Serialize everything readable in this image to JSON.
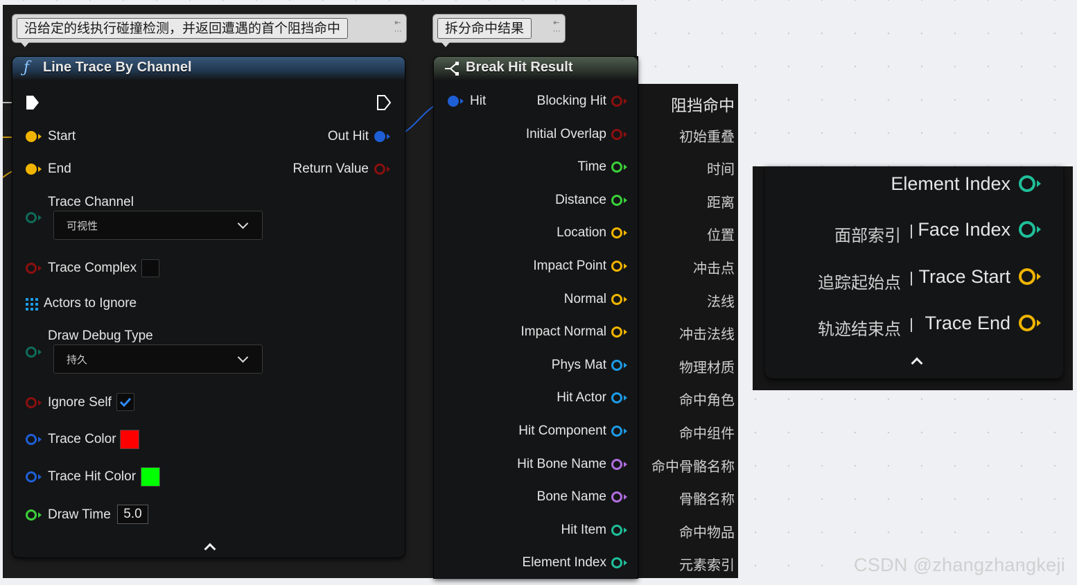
{
  "comments": {
    "trace_comment": "沿给定的线执行碰撞检测，并返回遭遇的首个阻挡命中",
    "break_comment": "拆分命中结果"
  },
  "line_trace": {
    "title": "Line Trace By Channel",
    "inputs": {
      "start": "Start",
      "end": "End",
      "trace_channel": "Trace Channel",
      "trace_channel_value": "可视性",
      "trace_complex": "Trace Complex",
      "actors_to_ignore": "Actors to Ignore",
      "draw_debug_type": "Draw Debug Type",
      "draw_debug_type_value": "持久",
      "ignore_self": "Ignore Self",
      "trace_color": "Trace Color",
      "trace_hit_color": "Trace Hit Color",
      "draw_time": "Draw Time",
      "draw_time_value": "5.0"
    },
    "outputs": {
      "out_hit": "Out Hit",
      "return_value": "Return Value"
    },
    "trace_complex_checked": false,
    "ignore_self_checked": true,
    "trace_color_hex": "#ff0000",
    "trace_hit_color_hex": "#00ff00"
  },
  "break_hit": {
    "title": "Break Hit Result",
    "input": "Hit",
    "outputs": [
      {
        "label": "Blocking Hit",
        "zh": "阻挡命中",
        "color": "#8b0f0f"
      },
      {
        "label": "Initial Overlap",
        "zh": "初始重叠",
        "color": "#8b0f0f"
      },
      {
        "label": "Time",
        "zh": "时间",
        "color": "#3bd13b"
      },
      {
        "label": "Distance",
        "zh": "距离",
        "color": "#3bd13b"
      },
      {
        "label": "Location",
        "zh": "位置",
        "color": "#f0b400"
      },
      {
        "label": "Impact Point",
        "zh": "冲击点",
        "color": "#f0b400"
      },
      {
        "label": "Normal",
        "zh": "法线",
        "color": "#f0b400"
      },
      {
        "label": "Impact Normal",
        "zh": "冲击法线",
        "color": "#f0b400"
      },
      {
        "label": "Phys Mat",
        "zh": "物理材质",
        "color": "#1d9be6"
      },
      {
        "label": "Hit Actor",
        "zh": "命中角色",
        "color": "#1d9be6"
      },
      {
        "label": "Hit Component",
        "zh": "命中组件",
        "color": "#1d9be6"
      },
      {
        "label": "Hit Bone Name",
        "zh": "命中骨骼名称",
        "color": "#b06ee0"
      },
      {
        "label": "Bone Name",
        "zh": "骨骼名称",
        "color": "#b06ee0"
      },
      {
        "label": "Hit Item",
        "zh": "命中物品",
        "color": "#1fbf9a"
      },
      {
        "label": "Element Index",
        "zh": "元素索引",
        "color": "#1fbf9a"
      }
    ]
  },
  "zoom_panel": {
    "rows": [
      {
        "label": "Element Index",
        "zh": "",
        "color": "#1fbf9a"
      },
      {
        "label": "Face Index",
        "zh": "面部索引",
        "color": "#1fbf9a"
      },
      {
        "label": "Trace Start",
        "zh": "追踪起始点",
        "color": "#f0b400"
      },
      {
        "label": "Trace End",
        "zh": "轨迹结束点",
        "color": "#f0b400"
      }
    ]
  },
  "watermark": "CSDN @zhangzhangkeji"
}
